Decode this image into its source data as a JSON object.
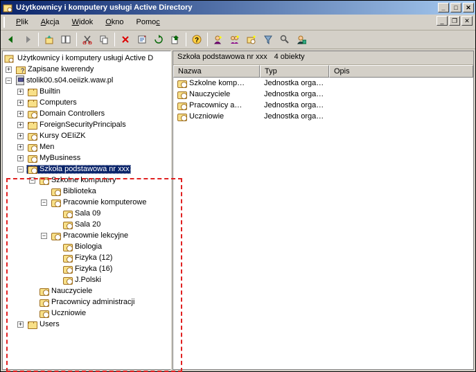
{
  "window": {
    "title": "Użytkownicy i komputery usługi Active Directory"
  },
  "menu": {
    "file": "Plik",
    "action": "Akcja",
    "view": "Widok",
    "window": "Okno",
    "help": "Pomoc"
  },
  "toolbar_icons": {
    "back": "back",
    "forward": "forward",
    "up": "up",
    "show": "show",
    "cut": "cut",
    "copy": "copy",
    "delete": "delete",
    "props": "properties",
    "refresh": "refresh",
    "export": "export",
    "help": "help",
    "filter": "filter",
    "find": "find",
    "newuser": "new-user",
    "newgroup": "new-group",
    "newou": "new-ou",
    "funnel": "funnel",
    "mass": "mass-add"
  },
  "status": {
    "path": "Szkoła podstawowa nr xxx",
    "count": "4 obiekty"
  },
  "list": {
    "cols": {
      "name": "Nazwa",
      "type": "Typ",
      "desc": "Opis"
    },
    "rows": [
      {
        "name": "Szkolne komp…",
        "type": "Jednostka orga…",
        "desc": ""
      },
      {
        "name": "Nauczyciele",
        "type": "Jednostka orga…",
        "desc": ""
      },
      {
        "name": "Pracownicy a…",
        "type": "Jednostka orga…",
        "desc": ""
      },
      {
        "name": "Uczniowie",
        "type": "Jednostka orga…",
        "desc": ""
      }
    ]
  },
  "tree": {
    "root": "Użytkownicy i komputery usługi Active D",
    "queries": "Zapisane kwerendy",
    "domain": "stolik00.s04.oeiizk.waw.pl",
    "builtin": "Builtin",
    "computers": "Computers",
    "dcs": "Domain Controllers",
    "fsp": "ForeignSecurityPrincipals",
    "kursy": "Kursy OEIiZK",
    "men": "Men",
    "mybusiness": "MyBusiness",
    "szkola": "Szkoła podstawowa nr xxx",
    "szkolne": "Szkolne komputery",
    "biblioteka": "Biblioteka",
    "pkomp": "Pracownie komputerowe",
    "sala09": "Sala 09",
    "sala20": "Sala 20",
    "plekc": "Pracownie lekcyjne",
    "biologia": "Biologia",
    "fizyka12": "Fizyka (12)",
    "fizyka16": "Fizyka (16)",
    "jpolski": "J.Polski",
    "nauczyciele": "Nauczyciele",
    "pracownicy": "Pracownicy administracji",
    "uczniowie": "Uczniowie",
    "users": "Users"
  }
}
